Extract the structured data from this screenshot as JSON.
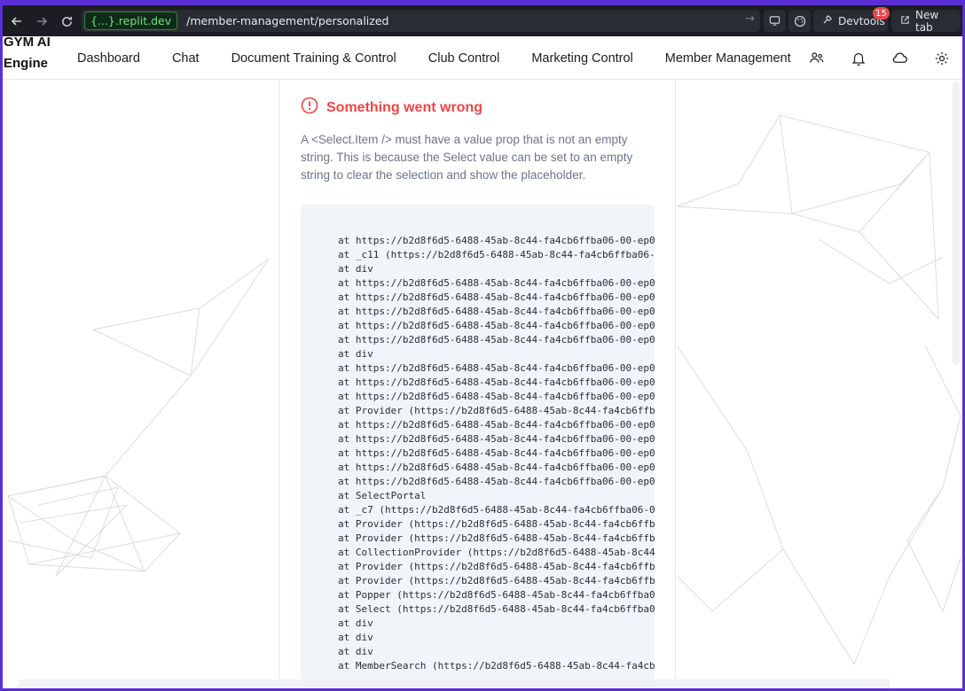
{
  "browser": {
    "domain": "{...}.replit.dev",
    "path": "/member-management/personalized",
    "devtools_label": "Devtools",
    "devtools_badge": "15",
    "newtab_label": "New tab"
  },
  "app": {
    "logo": "GYM AI Engine",
    "nav": [
      "Dashboard",
      "Chat",
      "Document Training & Control",
      "Club Control",
      "Marketing Control",
      "Member Management"
    ]
  },
  "error": {
    "title": "Something went wrong",
    "message": "A <Select.Item /> must have a value prop that is not an empty string. This is because the Select value can be set to an empty string to clear the selection and show the placeholder.",
    "stack": [
      "at https://b2d8f6d5-6488-45ab-8c44-fa4cb6ffba06-00-ep0",
      "at _c11 (https://b2d8f6d5-6488-45ab-8c44-fa4cb6ffba06-",
      "at div",
      "at https://b2d8f6d5-6488-45ab-8c44-fa4cb6ffba06-00-ep0",
      "at https://b2d8f6d5-6488-45ab-8c44-fa4cb6ffba06-00-ep0",
      "at https://b2d8f6d5-6488-45ab-8c44-fa4cb6ffba06-00-ep0",
      "at https://b2d8f6d5-6488-45ab-8c44-fa4cb6ffba06-00-ep0",
      "at https://b2d8f6d5-6488-45ab-8c44-fa4cb6ffba06-00-ep0",
      "at div",
      "at https://b2d8f6d5-6488-45ab-8c44-fa4cb6ffba06-00-ep0",
      "at https://b2d8f6d5-6488-45ab-8c44-fa4cb6ffba06-00-ep0",
      "at https://b2d8f6d5-6488-45ab-8c44-fa4cb6ffba06-00-ep0",
      "at Provider (https://b2d8f6d5-6488-45ab-8c44-fa4cb6ffb",
      "at https://b2d8f6d5-6488-45ab-8c44-fa4cb6ffba06-00-ep0",
      "at https://b2d8f6d5-6488-45ab-8c44-fa4cb6ffba06-00-ep0",
      "at https://b2d8f6d5-6488-45ab-8c44-fa4cb6ffba06-00-ep0",
      "at https://b2d8f6d5-6488-45ab-8c44-fa4cb6ffba06-00-ep0",
      "at https://b2d8f6d5-6488-45ab-8c44-fa4cb6ffba06-00-ep0",
      "at SelectPortal",
      "at _c7 (https://b2d8f6d5-6488-45ab-8c44-fa4cb6ffba06-0",
      "at Provider (https://b2d8f6d5-6488-45ab-8c44-fa4cb6ffb",
      "at Provider (https://b2d8f6d5-6488-45ab-8c44-fa4cb6ffb",
      "at CollectionProvider (https://b2d8f6d5-6488-45ab-8c44",
      "at Provider (https://b2d8f6d5-6488-45ab-8c44-fa4cb6ffb",
      "at Provider (https://b2d8f6d5-6488-45ab-8c44-fa4cb6ffb",
      "at Popper (https://b2d8f6d5-6488-45ab-8c44-fa4cb6ffba0",
      "at Select (https://b2d8f6d5-6488-45ab-8c44-fa4cb6ffba0",
      "at div",
      "at div",
      "at div",
      "at MemberSearch (https://b2d8f6d5-6488-45ab-8c44-fa4cb"
    ]
  },
  "colors": {
    "accent_error": "#ef4444",
    "frame": "#5b2fd6",
    "domain_green": "#6fe07b"
  }
}
